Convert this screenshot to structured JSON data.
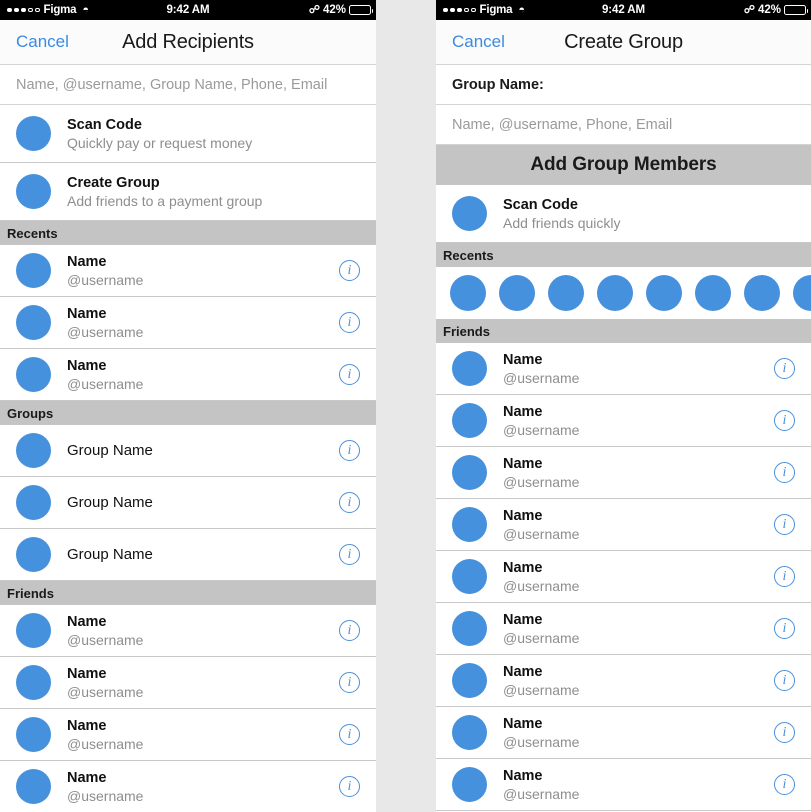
{
  "status_bar": {
    "signal_dots_filled": 3,
    "signal_dots_hollow": 2,
    "carrier": "Figma",
    "wifi_icon": "wifi-icon",
    "time": "9:42 AM",
    "bluetooth_icon": "bluetooth-icon",
    "battery_percent": "42%",
    "battery_level": 42
  },
  "colors": {
    "accent_blue": "#4591dd",
    "link_blue": "#3b8ae2",
    "info_blue": "#4a90d9",
    "section_gray": "#c4c4c4",
    "subtitle_gray": "#8e8e8e",
    "placeholder_gray": "#9a9a9a",
    "page_background": "#e8e8e8"
  },
  "screen_left": {
    "nav": {
      "cancel_label": "Cancel",
      "title": "Add Recipients"
    },
    "search": {
      "value": "",
      "placeholder": "Name, @username, Group Name, Phone, Email"
    },
    "actions": [
      {
        "title": "Scan Code",
        "subtitle": "Quickly pay or request money"
      },
      {
        "title": "Create Group",
        "subtitle": "Add friends to a payment group"
      }
    ],
    "sections": [
      {
        "header": "Recents",
        "row_type": "person",
        "rows": [
          {
            "title": "Name",
            "subtitle": "@username",
            "info": "i"
          },
          {
            "title": "Name",
            "subtitle": "@username",
            "info": "i"
          },
          {
            "title": "Name",
            "subtitle": "@username",
            "info": "i"
          }
        ]
      },
      {
        "header": "Groups",
        "row_type": "group",
        "rows": [
          {
            "title": "Group Name",
            "subtitle": "",
            "info": "i"
          },
          {
            "title": "Group Name",
            "subtitle": "",
            "info": "i"
          },
          {
            "title": "Group Name",
            "subtitle": "",
            "info": "i"
          }
        ]
      },
      {
        "header": "Friends",
        "row_type": "person",
        "rows": [
          {
            "title": "Name",
            "subtitle": "@username",
            "info": "i"
          },
          {
            "title": "Name",
            "subtitle": "@username",
            "info": "i"
          },
          {
            "title": "Name",
            "subtitle": "@username",
            "info": "i"
          },
          {
            "title": "Name",
            "subtitle": "@username",
            "info": "i"
          }
        ]
      }
    ]
  },
  "screen_right": {
    "nav": {
      "cancel_label": "Cancel",
      "title": "Create Group"
    },
    "group_name_label": "Group Name:",
    "search": {
      "value": "",
      "placeholder": "Name, @username, Phone, Email"
    },
    "add_members_header": "Add Group Members",
    "actions": [
      {
        "title": "Scan Code",
        "subtitle": "Add friends quickly"
      }
    ],
    "recents": {
      "header": "Recents",
      "avatar_count": 8
    },
    "friends": {
      "header": "Friends",
      "rows": [
        {
          "title": "Name",
          "subtitle": "@username",
          "info": "i"
        },
        {
          "title": "Name",
          "subtitle": "@username",
          "info": "i"
        },
        {
          "title": "Name",
          "subtitle": "@username",
          "info": "i"
        },
        {
          "title": "Name",
          "subtitle": "@username",
          "info": "i"
        },
        {
          "title": "Name",
          "subtitle": "@username",
          "info": "i"
        },
        {
          "title": "Name",
          "subtitle": "@username",
          "info": "i"
        },
        {
          "title": "Name",
          "subtitle": "@username",
          "info": "i"
        },
        {
          "title": "Name",
          "subtitle": "@username",
          "info": "i"
        },
        {
          "title": "Name",
          "subtitle": "@username",
          "info": "i"
        }
      ]
    }
  }
}
